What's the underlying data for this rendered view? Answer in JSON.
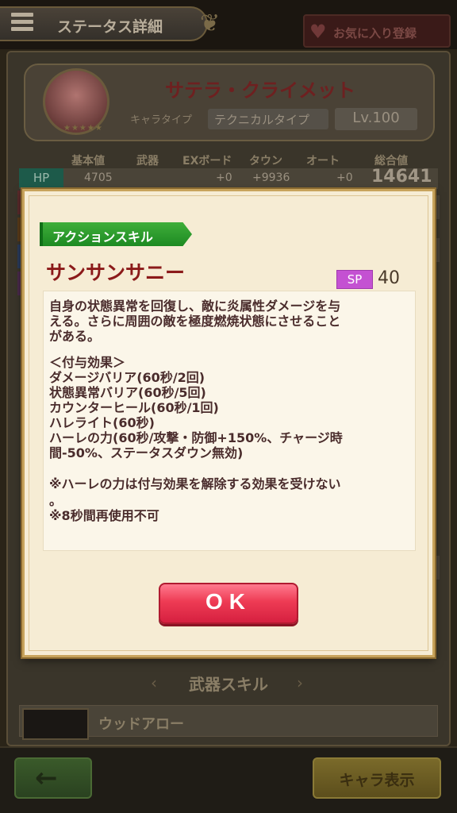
{
  "header": {
    "title": "ステータス詳細",
    "favorite_label": "お気に入り登録"
  },
  "character": {
    "name": "サテラ・クライメット",
    "type_label": "キャラタイプ",
    "type_value": "テクニカルタイプ",
    "level": "Lv.100",
    "stars": "★★★★★"
  },
  "stats": {
    "headers": [
      "基本値",
      "武器",
      "EXボード",
      "タウン",
      "オート",
      "総合値"
    ],
    "hp": {
      "label": "HP",
      "base": "4705",
      "exboard": "+0",
      "town": "+9936",
      "auto": "+0",
      "total": "14641"
    }
  },
  "weapon_section": {
    "title": "武器スキル",
    "weapon_name": "ウッドアロー"
  },
  "bottom": {
    "back_label": "←",
    "chara_display_label": "キャラ表示"
  },
  "dialog": {
    "tag": "アクションスキル",
    "skill_name": "サンサンサニー",
    "sp_label": "SP",
    "sp_value": "40",
    "description_lines": [
      "自身の状態異常を回復し、敵に炎属性ダメージを与",
      "える。さらに周囲の敵を極度燃焼状態にさせること",
      "がある。",
      "",
      "＜付与効果＞",
      "ダメージバリア(60秒/2回)",
      "状態異常バリア(60秒/5回)",
      "カウンターヒール(60秒/1回)",
      "ハレライト(60秒)",
      "ハーレの力(60秒/攻撃・防御+150%、チャージ時",
      "間-50%、ステータスダウン無効)",
      "",
      "※ハーレの力は付与効果を解除する効果を受けない",
      "。",
      "※8秒間再使用不可"
    ],
    "ok_label": "OK"
  },
  "colors": {
    "skill_name": "#8b1a1a",
    "tag_green": "#1d8a22",
    "sp_badge": "#c451d2",
    "ok_button": "#ee3b54"
  }
}
